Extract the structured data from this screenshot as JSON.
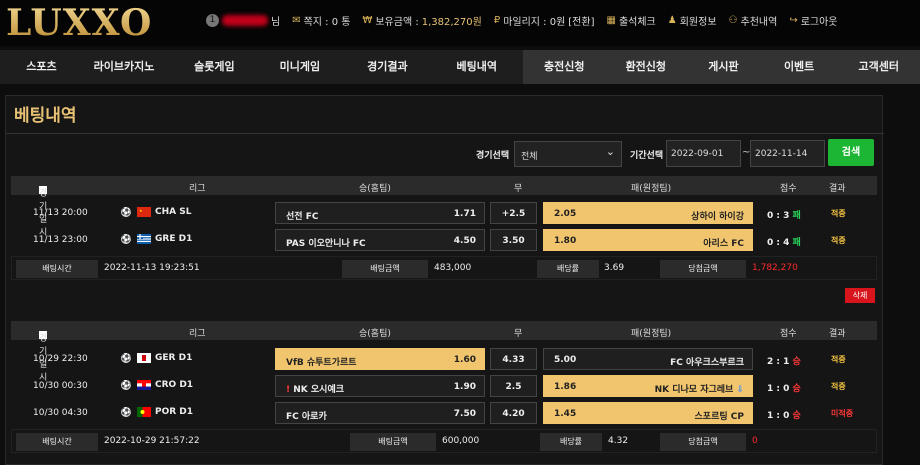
{
  "logo": "LUXXO",
  "top": {
    "level": "1",
    "name_suffix": "님",
    "msg_label": "쪽지 : 0 통",
    "balance_label": "보유금액 : ",
    "balance": "1,382,270원",
    "mileage_label": "마일리지 : 0원",
    "convert": "[전환]",
    "attend": "출석체크",
    "member": "회원정보",
    "recommend": "추천내역",
    "logout": "로그아웃"
  },
  "nav": [
    "스포츠",
    "라이브카지노",
    "슬롯게임",
    "미니게임",
    "경기결과",
    "베팅내역",
    "충전신청",
    "환전신청",
    "게시판",
    "이벤트",
    "고객센터"
  ],
  "title": "베팅내역",
  "filter": {
    "game_label": "경기선택",
    "game_value": "전체",
    "period_label": "기간선택",
    "date_from": "2022-09-01",
    "tilde": "~",
    "date_to": "2022-11-14",
    "search": "검색"
  },
  "headers": {
    "time": "경기일시",
    "league": "리그",
    "home": "승(홈팀)",
    "draw": "무",
    "away": "패(원정팀)",
    "score": "점수",
    "result": "결과"
  },
  "summary_labels": {
    "bet_time": "배팅시간",
    "bet_amount": "배팅금액",
    "odds": "배당률",
    "win_amount": "당첨금액"
  },
  "delete": "삭제",
  "bets": [
    {
      "rows": [
        {
          "time": "11/13 20:00",
          "league": "CHA SL",
          "home": "선전 FC",
          "home_odds": "1.71",
          "draw": "+2.5",
          "away_odds": "2.05",
          "away": "상하이 하이강",
          "score_a": "0 : 3",
          "score_m": "패",
          "result": "적중"
        },
        {
          "time": "11/13 23:00",
          "league": "GRE D1",
          "home": "PAS 이오안니나 FC",
          "home_odds": "4.50",
          "draw": "3.50",
          "away_odds": "1.80",
          "away": "아리스 FC",
          "score_a": "0 : 4",
          "score_m": "패",
          "result": "적중"
        }
      ],
      "bet_time": "2022-11-13 19:23:51",
      "bet_amount": "483,000",
      "odds": "3.69",
      "win_amount": "1,782,270"
    },
    {
      "rows": [
        {
          "time": "10/29 22:30",
          "league": "GER D1",
          "home": "VfB 슈투트가르트",
          "home_odds": "1.60",
          "draw": "4.33",
          "away_odds": "5.00",
          "away": "FC 아우크스부르크",
          "score_a": "2 : 1",
          "score_m": "승",
          "result": "적중"
        },
        {
          "time": "10/30 00:30",
          "league": "CRO D1",
          "home": "NK 오시예크",
          "home_odds": "1.90",
          "draw": "2.5",
          "away_odds": "1.86",
          "away": "NK 디나모 자그레브",
          "score_a": "1 : 0",
          "score_m": "승",
          "result": "적중"
        },
        {
          "time": "10/30 04:30",
          "league": "POR D1",
          "home": "FC 아로카",
          "home_odds": "7.50",
          "draw": "4.20",
          "away_odds": "1.45",
          "away": "스포르팅 CP",
          "score_a": "1 : 0",
          "score_m": "승",
          "result": "미적중"
        }
      ],
      "bet_time": "2022-10-29 21:57:22",
      "bet_amount": "600,000",
      "odds": "4.32",
      "win_amount": "0"
    }
  ]
}
